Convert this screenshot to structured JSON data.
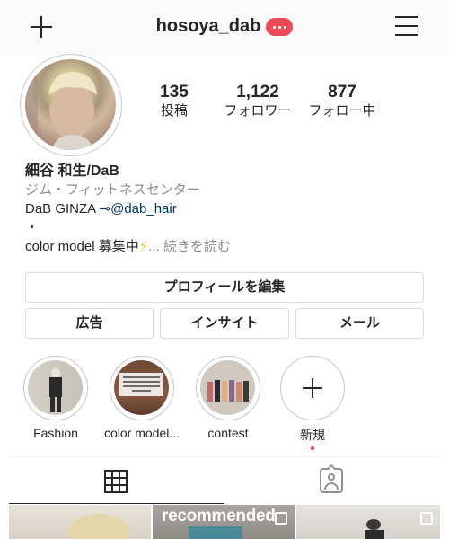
{
  "header": {
    "username": "hosoya_dab"
  },
  "stats": [
    {
      "value": "135",
      "label": "投稿"
    },
    {
      "value": "1,122",
      "label": "フォロワー"
    },
    {
      "value": "877",
      "label": "フォロー中"
    }
  ],
  "bio": {
    "name": "細谷 和生/DaB",
    "category": "ジム・フィットネスセンター",
    "line1_prefix": "DaB GINZA ",
    "line1_arrow": "⊸",
    "line1_link": "@dab_hair",
    "line2": "・",
    "line3": "color model 募集中",
    "bolt": "⚡",
    "more": "... 続きを読む"
  },
  "buttons": {
    "edit_profile": "プロフィールを編集",
    "ads": "広告",
    "insights": "インサイト",
    "email": "メール"
  },
  "highlights": [
    {
      "label": "Fashion"
    },
    {
      "label": "color model..."
    },
    {
      "label": "contest"
    },
    {
      "label": "新規"
    }
  ],
  "posts": [
    {
      "overlay": ""
    },
    {
      "overlay": "recommended"
    },
    {
      "overlay": ""
    }
  ]
}
